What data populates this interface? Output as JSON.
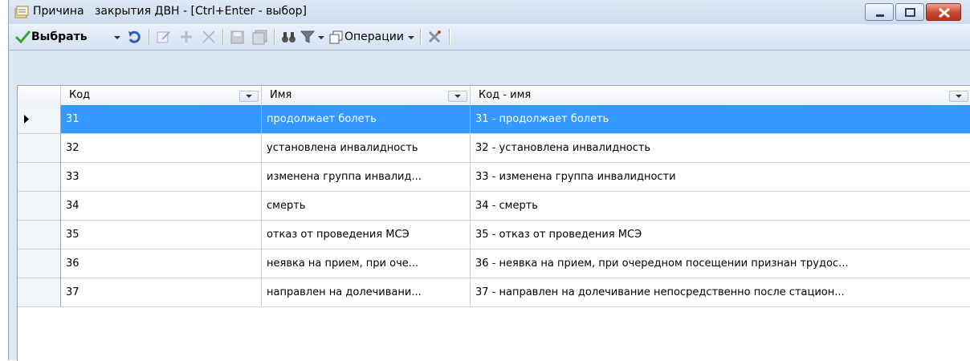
{
  "window": {
    "title": "Причина   закрытия ДВН - [Ctrl+Enter - выбор]"
  },
  "toolbar": {
    "select_label": "Выбрать",
    "operations_label": "Операции"
  },
  "columns": [
    "Код",
    "Имя",
    "Код - имя"
  ],
  "rows": [
    {
      "code": "31",
      "name": "продолжает болеть",
      "code_name": "31 - продолжает болеть"
    },
    {
      "code": "32",
      "name": "установлена инвалидность",
      "code_name": "32 - установлена инвалидность"
    },
    {
      "code": "33",
      "name": "изменена группа инвалид...",
      "code_name": "33 - изменена группа инвалидности"
    },
    {
      "code": "34",
      "name": "смерть",
      "code_name": "34 - смерть"
    },
    {
      "code": "35",
      "name": "отказ от проведения МСЭ",
      "code_name": "35 - отказ от проведения МСЭ"
    },
    {
      "code": "36",
      "name": "неявка на прием, при оче...",
      "code_name": "36 - неявка на прием, при очередном посещении признан трудос..."
    },
    {
      "code": "37",
      "name": "направлен на долечивани...",
      "code_name": "37 - направлен на долечивание непосредственно после стацион..."
    }
  ],
  "colors": {
    "selection": "#3399ff",
    "accent_green": "#3aa635"
  },
  "icons": [
    "form-icon",
    "check-icon",
    "refresh-icon",
    "edit-icon",
    "add-icon",
    "delete-icon",
    "save-icon",
    "save-all-icon",
    "binoculars-icon",
    "filter-icon",
    "operations-icon",
    "tools-icon",
    "minimize-icon",
    "maximize-icon",
    "close-icon"
  ]
}
